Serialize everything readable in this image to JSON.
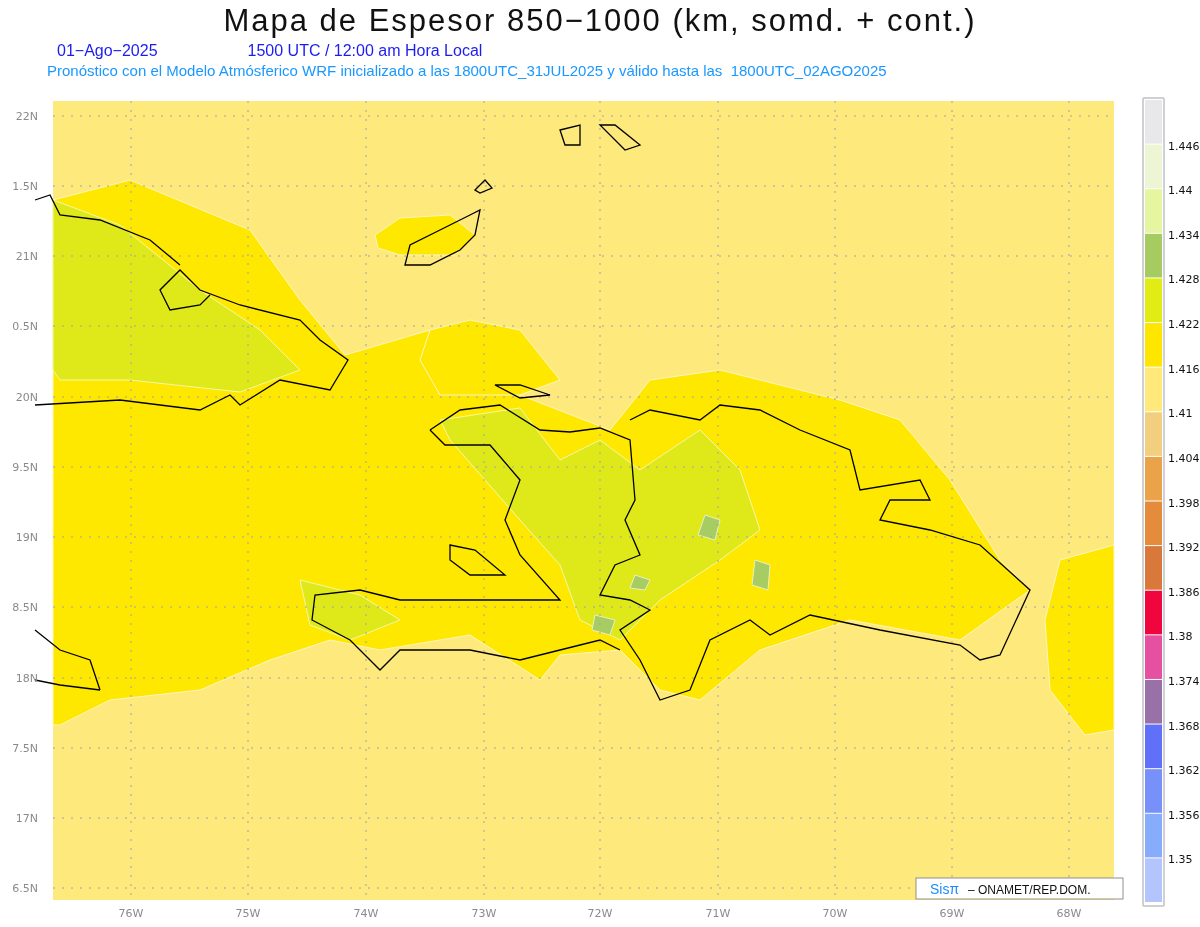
{
  "title": "Mapa de Espesor 850−1000 (km, somd. + cont.)",
  "date": "01−Ago−2025",
  "time": "1500 UTC / 12:00 am Hora Local",
  "subtitle": "Pronóstico con el Modelo Atmósferico WRF inicializado a las 1800UTC_31JUL2025 y válido hasta las  1800UTC_02AGO2025",
  "map": {
    "latitude_labels": [
      "22N",
      "1.5N",
      "21N",
      "0.5N",
      "20N",
      "9.5N",
      "19N",
      "8.5N",
      "18N",
      "7.5N",
      "17N",
      "6.5N"
    ],
    "longitude_labels": [
      "76W",
      "75W",
      "74W",
      "73W",
      "72W",
      "71W",
      "70W",
      "69W",
      "68W"
    ]
  },
  "colorbar": {
    "segments": [
      {
        "color": "#e8e8e8"
      },
      {
        "color": "#eef5d4"
      },
      {
        "color": "#e6f5a0"
      },
      {
        "color": "#a6cb60"
      },
      {
        "color": "#e1eb14"
      },
      {
        "color": "#ffe600"
      },
      {
        "color": "#ffe97a"
      },
      {
        "color": "#f2cf7e"
      },
      {
        "color": "#eba34a"
      },
      {
        "color": "#e58c3c"
      },
      {
        "color": "#d8783a"
      },
      {
        "color": "#f0053f"
      },
      {
        "color": "#e650a0"
      },
      {
        "color": "#9a70a8"
      },
      {
        "color": "#6070f8"
      },
      {
        "color": "#7890fa"
      },
      {
        "color": "#88acfc"
      },
      {
        "color": "#b4c4fc"
      }
    ],
    "labels": [
      "1.446",
      "1.44",
      "1.434",
      "1.428",
      "1.422",
      "1.416",
      "1.41",
      "1.404",
      "1.398",
      "1.392",
      "1.386",
      "1.38",
      "1.374",
      "1.368",
      "1.362",
      "1.356",
      "1.35"
    ]
  },
  "credit": {
    "logo": "Sisπ",
    "text": "– ONAMET/REP.DOM."
  }
}
